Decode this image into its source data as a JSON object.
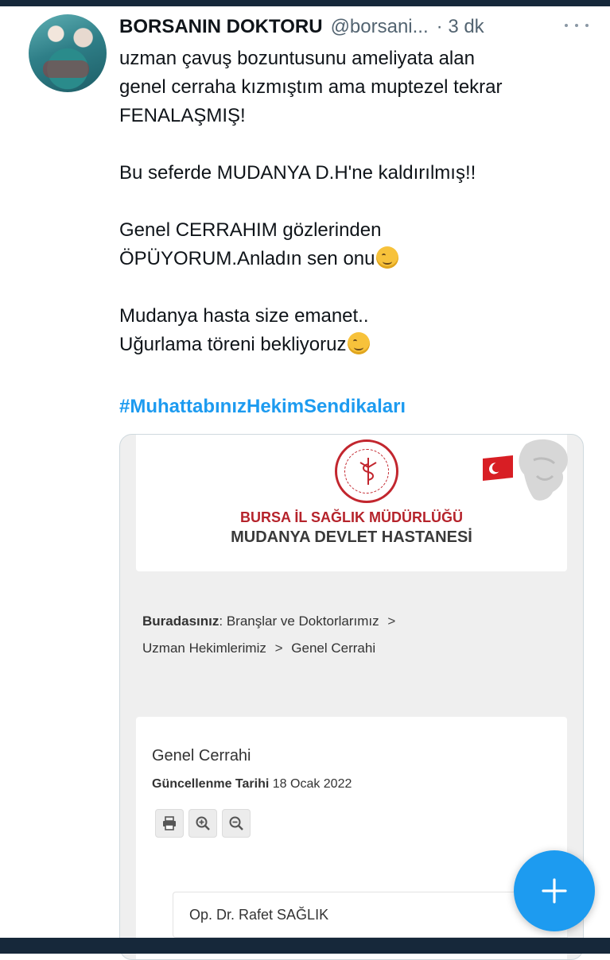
{
  "tweet": {
    "display_name": "BORSANIN DOKTORU",
    "handle": "@borsani...",
    "time": "· 3 dk",
    "lines": {
      "l1": "uzman çavuş bozuntusunu ameliyata alan",
      "l2": "genel cerraha kızmıştım ama  muptezel tekrar",
      "l3": "FENALAŞMIŞ!",
      "l4": "Bu seferde MUDANYA D.H'ne kaldırılmış!!",
      "l5": "Genel CERRAHIM gözlerinden",
      "l6": "ÖPÜYORUM.Anladın sen onu",
      "l7": "Mudanya hasta size emanet..",
      "l8": "Uğurlama töreni bekliyoruz"
    },
    "hashtag": "#MuhattabınızHekimSendikaları"
  },
  "card": {
    "org_line1": "BURSA İL SAĞLIK MÜDÜRLÜĞÜ",
    "org_line2": "MUDANYA DEVLET HASTANESİ",
    "breadcrumb": {
      "label": "Buradasınız",
      "colon": ":",
      "item1": "Branşlar ve Doktorlarımız",
      "item2": "Uzman Hekimlerimiz",
      "item3": "Genel Cerrahi",
      "sep": ">"
    },
    "content_title": "Genel Cerrahi",
    "update_label": "Güncellenme Tarihi",
    "update_date": "18 Ocak 2022",
    "doctor_name": "Op. Dr. Rafet SAĞLIK"
  },
  "colors": {
    "accent": "#1d9bf0",
    "brand_red": "#c2262e",
    "bar": "#16283a"
  },
  "icons": [
    "more-icon",
    "print-icon",
    "zoom-in-icon",
    "zoom-out-icon",
    "compose-plus-icon"
  ]
}
